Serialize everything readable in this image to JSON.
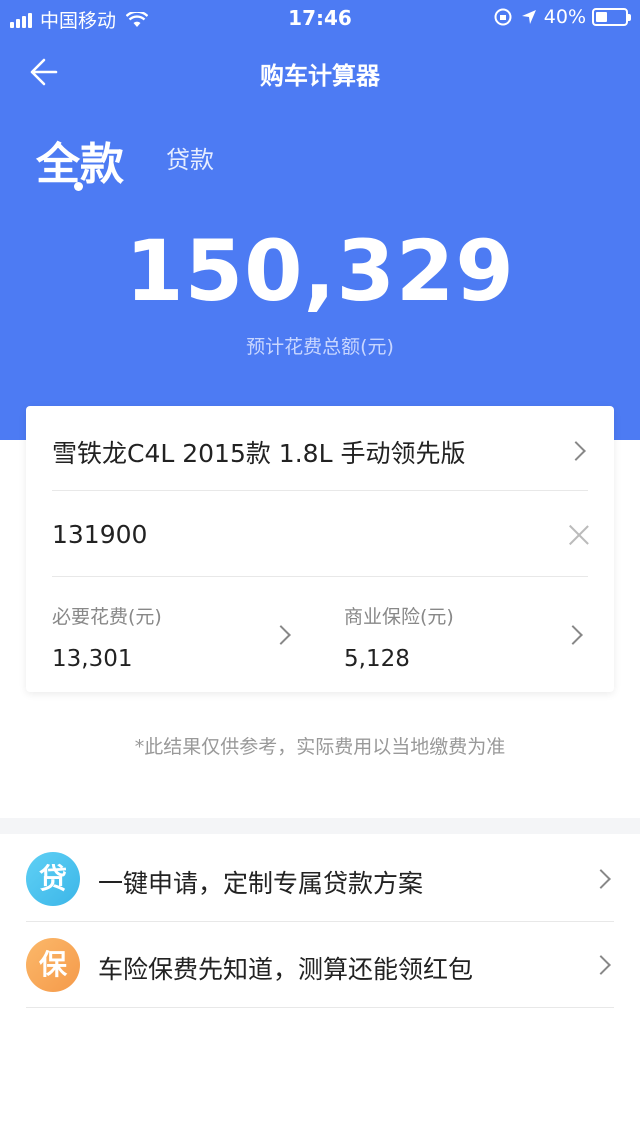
{
  "status_bar": {
    "carrier": "中国移动",
    "time": "17:46",
    "battery": "40%",
    "battery_level": 0.4
  },
  "nav": {
    "title": "购车计算器"
  },
  "tabs": {
    "full": "全款",
    "loan": "贷款"
  },
  "summary": {
    "total": "150,329",
    "label": "预计花费总额(元)"
  },
  "card": {
    "car_model": "雪铁龙C4L 2015款 1.8L 手动领先版",
    "price": "131900",
    "required_fee_label": "必要花费(元)",
    "required_fee_value": "13,301",
    "insurance_label": "商业保险(元)",
    "insurance_value": "5,128"
  },
  "note": "*此结果仅供参考，实际费用以当地缴费为准",
  "promos": [
    {
      "icon_char": "贷",
      "text": "一键申请，定制专属贷款方案"
    },
    {
      "icon_char": "保",
      "text": "车险保费先知道，测算还能领红包"
    }
  ],
  "colors": {
    "primary": "#4d7bf3",
    "loan_icon": "#3cb6e8",
    "insurance_icon": "#f59a4a"
  }
}
